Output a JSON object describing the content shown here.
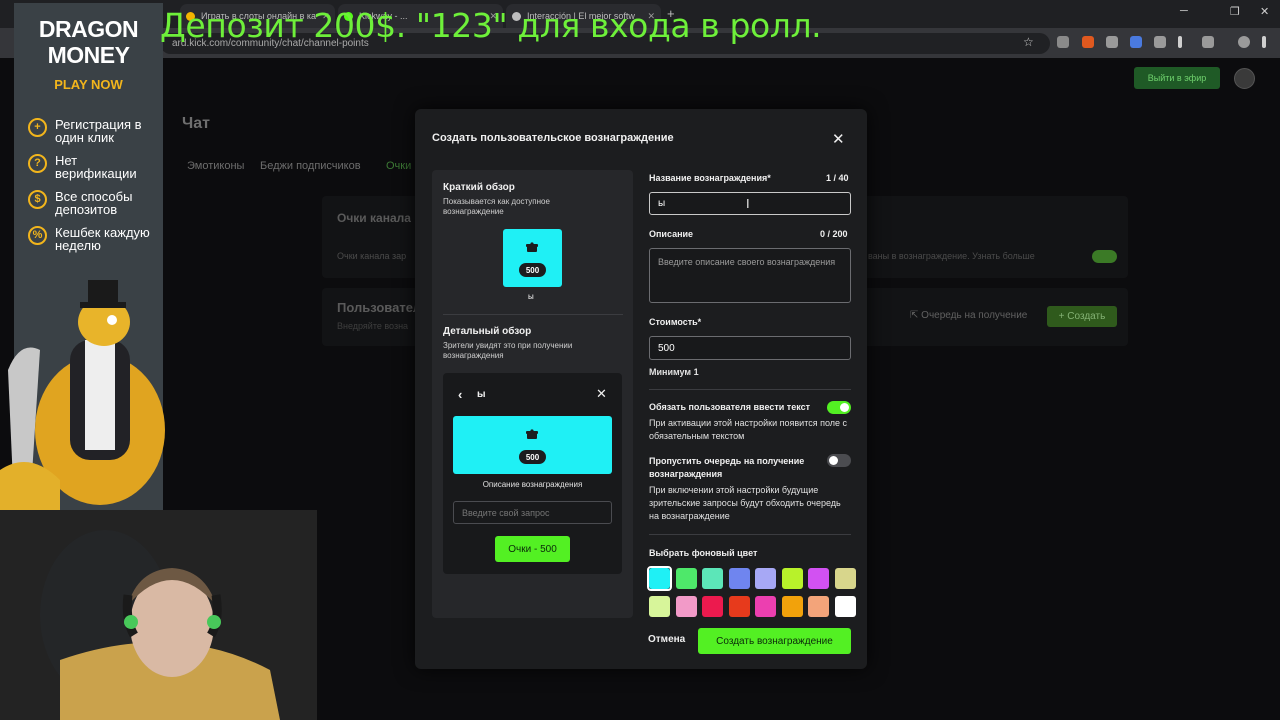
{
  "browser": {
    "tabs": [
      {
        "label": "Играть в слоты онлайн в ка",
        "icon": "coin-icon",
        "color": "#f4b400"
      },
      {
        "label": "Kickway - ...",
        "icon": "kick-icon",
        "color": "#53fc18"
      },
      {
        "label": "Interacción | El mejor softw",
        "icon": "puzzle-icon",
        "color": "#bdbdbd"
      }
    ],
    "url": "ard.kick.com/community/chat/channel-points"
  },
  "page": {
    "go_live_label": "Выйти в эфир",
    "chat_title": "Чат",
    "tabs": [
      "Эмотиконы",
      "Беджи подписчиков",
      "Очки"
    ],
    "points_card": {
      "title": "Очки канала",
      "text": "Очки канала зар",
      "right_text": "ваны в вознаграждение. Узнать больше"
    },
    "rewards_card": {
      "title": "Пользовател",
      "subtitle": "Внедряйте возна",
      "queue_label": "Очередь на получение",
      "create_label": "Создать"
    }
  },
  "modal": {
    "title": "Создать пользовательское вознаграждение",
    "preview": {
      "short_title": "Краткий обзор",
      "short_subtitle": "Показывается как доступное вознаграждение",
      "cost": "500",
      "reward_name": "ы",
      "detail_title": "Детальный обзор",
      "detail_subtitle": "Зрители увидят это при получении вознаграждения",
      "detail_description": "Описание вознаграждения",
      "detail_input_placeholder": "Введите свой запрос",
      "detail_button": "Очки - 500"
    },
    "form": {
      "name_label": "Название вознаграждения*",
      "name_count": "1 / 40",
      "name_value": "ы",
      "description_label": "Описание",
      "description_count": "0 / 200",
      "description_placeholder": "Введите описание своего вознаграждения",
      "cost_label": "Стоимость*",
      "cost_value": "500",
      "cost_hint": "Минимум 1",
      "require_text_title": "Обязать пользователя ввести текст",
      "require_text_on": true,
      "require_text_desc": "При активации этой настройки появится поле с обязательным текстом",
      "skip_queue_title": "Пропустить очередь на получение вознаграждения",
      "skip_queue_on": false,
      "skip_queue_desc": "При включении этой настройки будущие зрительские запросы будут обходить очередь на вознаграждение",
      "color_label": "Выбрать фоновый цвет",
      "colors": [
        "#1ff0f5",
        "#4ee86a",
        "#5ce6b8",
        "#6f85ef",
        "#a7a8f5",
        "#b8f22a",
        "#d251f2",
        "#d8d68c",
        "#d7f59a",
        "#f29ac8",
        "#ec1a4e",
        "#e73a1c",
        "#ec3fb0",
        "#f2a20b",
        "#f3a47a",
        "#ffffff"
      ],
      "selected_color": "#1ff0f5",
      "cancel_label": "Отмена",
      "submit_label": "Создать вознаграждение"
    }
  },
  "overlay": {
    "banner": "Депозит 200$. \"123\" для входа в ролл.",
    "promo": {
      "brand_line1": "DRAGON",
      "brand_line2": "MONEY",
      "cta": "PLAY NOW",
      "items": [
        {
          "text": "Регистрация в один клик",
          "icon": "plus-icon"
        },
        {
          "text": "Нет верификации",
          "icon": "question-icon"
        },
        {
          "text": "Все способы депозитов",
          "icon": "dollar-icon"
        },
        {
          "text": "Кешбек каждую неделю",
          "icon": "percent-icon"
        }
      ]
    }
  }
}
